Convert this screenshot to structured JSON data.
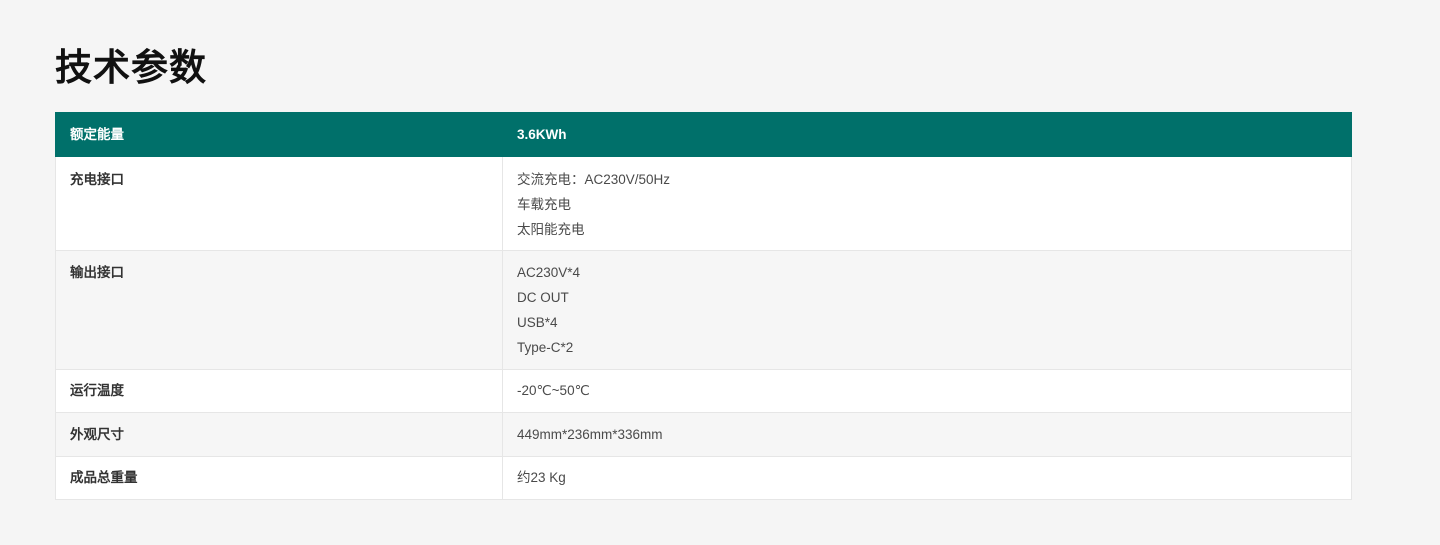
{
  "title": "技术参数",
  "table": {
    "header": {
      "label": "额定能量",
      "value": "3.6KWh"
    },
    "rows": [
      {
        "label": "充电接口",
        "lines": [
          "交流充电：AC230V/50Hz",
          "车载充电",
          "太阳能充电"
        ]
      },
      {
        "label": "输出接口",
        "lines": [
          "AC230V*4",
          "DC OUT",
          "USB*4",
          "Type-C*2"
        ]
      },
      {
        "label": "运行温度",
        "lines": [
          "-20℃~50℃"
        ]
      },
      {
        "label": "外观尺寸",
        "lines": [
          "449mm*236mm*336mm"
        ]
      },
      {
        "label": "成品总重量",
        "lines": [
          "约23 Kg"
        ]
      }
    ]
  },
  "colors": {
    "header_bg": "#00706a",
    "page_bg": "#f5f5f5",
    "row_alt_bg": "#f6f6f6",
    "border": "#e6e6e6"
  }
}
